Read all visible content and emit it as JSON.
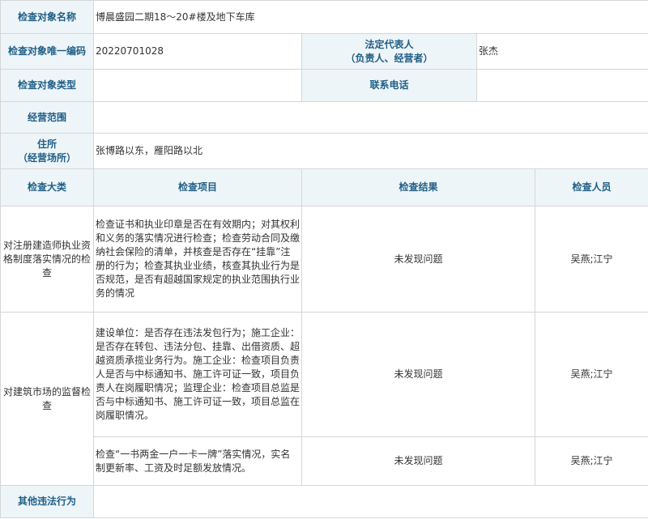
{
  "rows": {
    "name": {
      "label": "检查对象名称",
      "value": "博晨盛园二期18～20#楼及地下车库"
    },
    "code": {
      "label": "检查对象唯一编码",
      "value": "20220701028",
      "legal_rep_label_1": "法定代表人",
      "legal_rep_label_2": "（负责人、经营者）",
      "legal_rep_value": "张杰"
    },
    "type": {
      "label": "检查对象类型",
      "value": "",
      "phone_label": "联系电话",
      "phone_value": ""
    },
    "scope": {
      "label": "经营范围",
      "value": ""
    },
    "address": {
      "label_1": "住所",
      "label_2": "（经营场所）",
      "value": "张博路以东，雁阳路以北"
    }
  },
  "headers": {
    "category": "检查大类",
    "item": "检查项目",
    "result": "检查结果",
    "inspector": "检查人员"
  },
  "inspections": [
    {
      "category": "对注册建造师执业资格制度落实情况的检查",
      "item": "检查证书和执业印章是否在有效期内；对其权利和义务的落实情况进行检查；检查劳动合同及缴纳社会保险的清单，并核查是否存在“挂靠”注册的行为；检查其执业业绩，核查其执业行为是否规范，是否有超越国家规定的执业范围执行业务的情况",
      "result": "未发现问题",
      "inspector": "吴燕;江宁"
    },
    {
      "category": "对建筑市场的监督检查",
      "item": "建设单位：是否存在违法发包行为；施工企业：是否存在转包、违法分包、挂靠、出借资质、超越资质承揽业务行为。施工企业：检查项目负责人是否与中标通知书、施工许可证一致，项目负责人在岗履职情况；监理企业：检查项目总监是否与中标通知书、施工许可证一致，项目总监在岗履职情况。",
      "result": "未发现问题",
      "inspector": "吴燕;江宁"
    },
    {
      "category": "",
      "item": "检查“一书两金一户一卡一牌”落实情况，实名制更新率、工资及时足额发放情况。",
      "result": "未发现问题",
      "inspector": "吴燕;江宁"
    }
  ],
  "other": {
    "label": "其他违法行为",
    "value": ""
  }
}
